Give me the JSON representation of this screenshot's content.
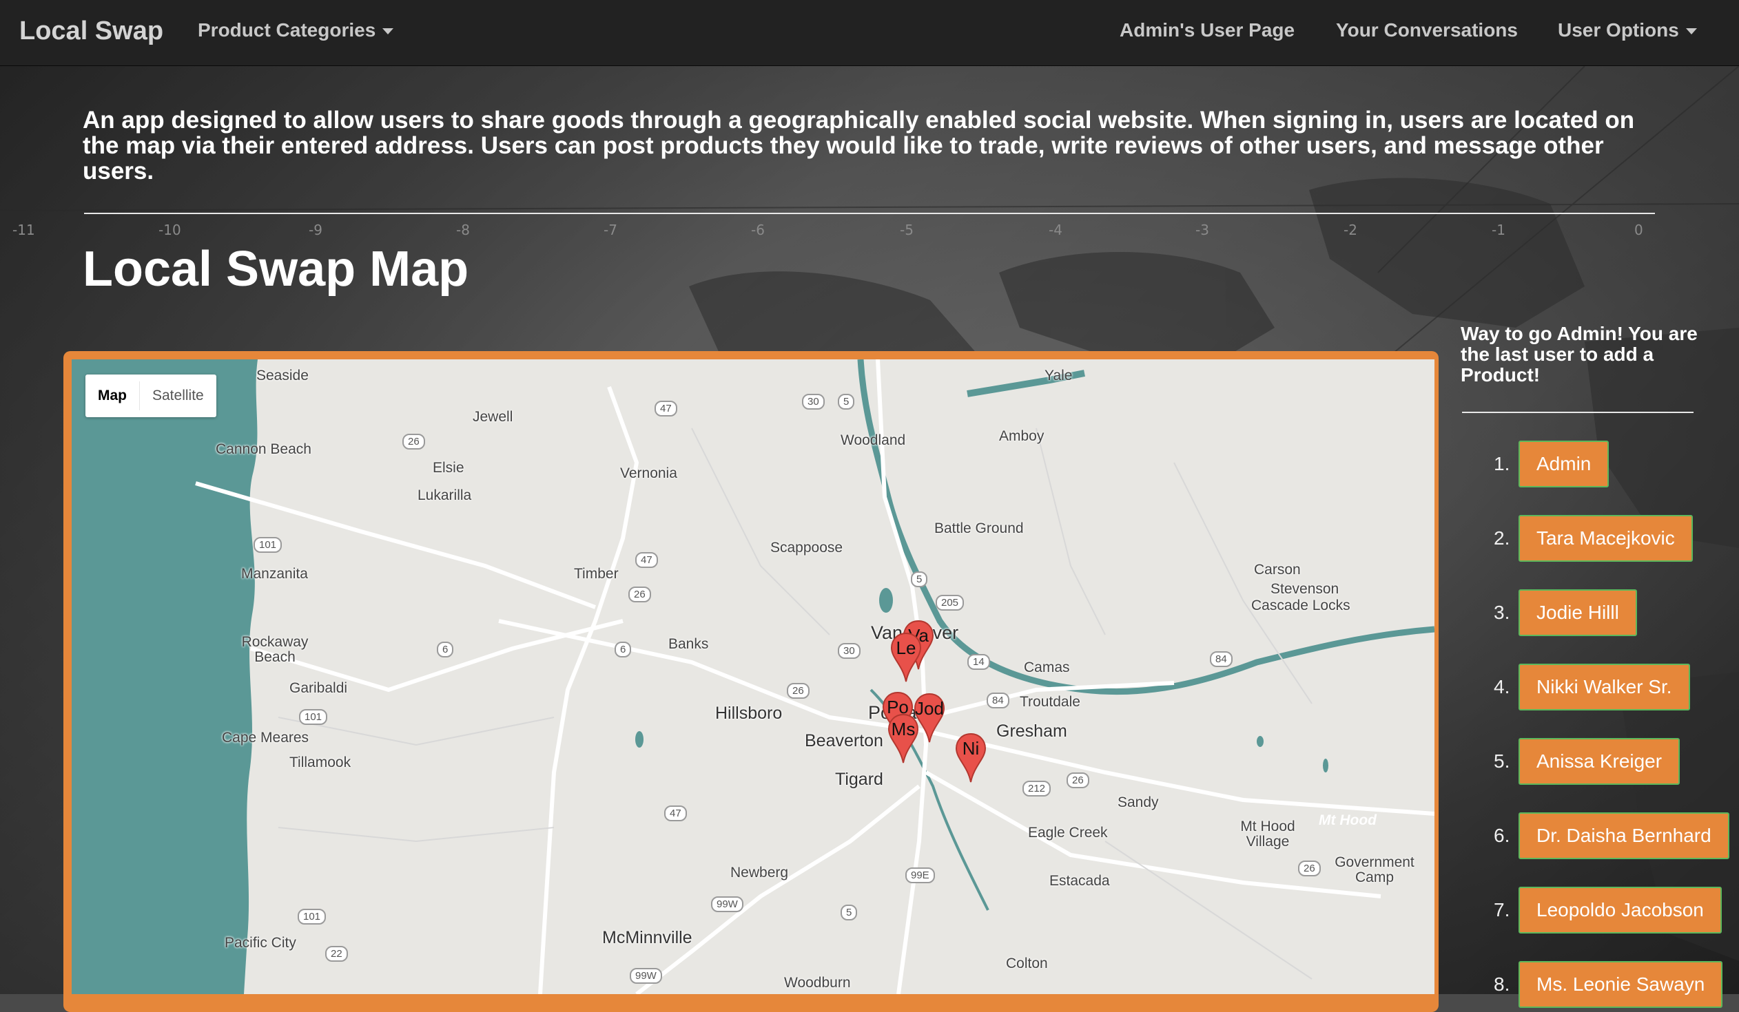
{
  "navbar": {
    "brand": "Local Swap",
    "categories": "Product Categories",
    "admin_page": "Admin's User Page",
    "conversations": "Your Conversations",
    "user_options": "User Options"
  },
  "intro": "An app designed to allow users to share goods through a geographically enabled social website. When signing in, users are located on the map via their entered address. Users can post products they would like to trade, write reviews of other users, and message other users.",
  "map_title": "Local Swap Map",
  "map": {
    "toggle_map": "Map",
    "toggle_satellite": "Satellite",
    "places": [
      "Seaside",
      "Jewell",
      "Cannon Beach",
      "Elsie",
      "Lukarilla",
      "Vernonia",
      "Manzanita",
      "Timber",
      "Rockaway Beach",
      "Garibaldi",
      "Banks",
      "Cape Meares",
      "Tillamook",
      "Hillsboro",
      "Beaverton",
      "Tigard",
      "Newberg",
      "McMinnville",
      "Pacific City",
      "Woodburn",
      "Colton",
      "Estacada",
      "Eagle Creek",
      "Sandy",
      "Gresham",
      "Troutdale",
      "Camas",
      "Battle Ground",
      "Amboy",
      "Yale",
      "Woodland",
      "Scappoose",
      "Carson",
      "Stevenson",
      "Cascade Locks",
      "Mt Hood Village",
      "Government Camp",
      "Mt Hood"
    ],
    "cities": [
      "Vancouver",
      "Portland"
    ],
    "shields": [
      "30",
      "5",
      "47",
      "26",
      "101",
      "47",
      "26",
      "6",
      "26",
      "5",
      "205",
      "30",
      "14",
      "84",
      "84",
      "6",
      "101",
      "47",
      "212",
      "26",
      "99E",
      "99W",
      "5",
      "101",
      "22",
      "99W",
      "26"
    ],
    "pins": [
      "Va",
      "Le",
      "Po",
      "Jod",
      "Ms",
      "Ni"
    ]
  },
  "side": {
    "message": "Way to go Admin! You are the last user to add a Product!",
    "users": [
      {
        "num": "1.",
        "name": "Admin"
      },
      {
        "num": "2.",
        "name": "Tara Macejkovic"
      },
      {
        "num": "3.",
        "name": "Jodie Hilll"
      },
      {
        "num": "4.",
        "name": "Nikki Walker Sr."
      },
      {
        "num": "5.",
        "name": "Anissa Kreiger"
      },
      {
        "num": "6.",
        "name": "Dr. Daisha Bernhard"
      },
      {
        "num": "7.",
        "name": "Leopoldo Jacobson"
      },
      {
        "num": "8.",
        "name": "Ms. Leonie Sawayn"
      }
    ]
  },
  "colors": {
    "accent": "#e6873a",
    "navbar": "#222222",
    "water": "#5b9896",
    "pin": "#e8514a"
  }
}
